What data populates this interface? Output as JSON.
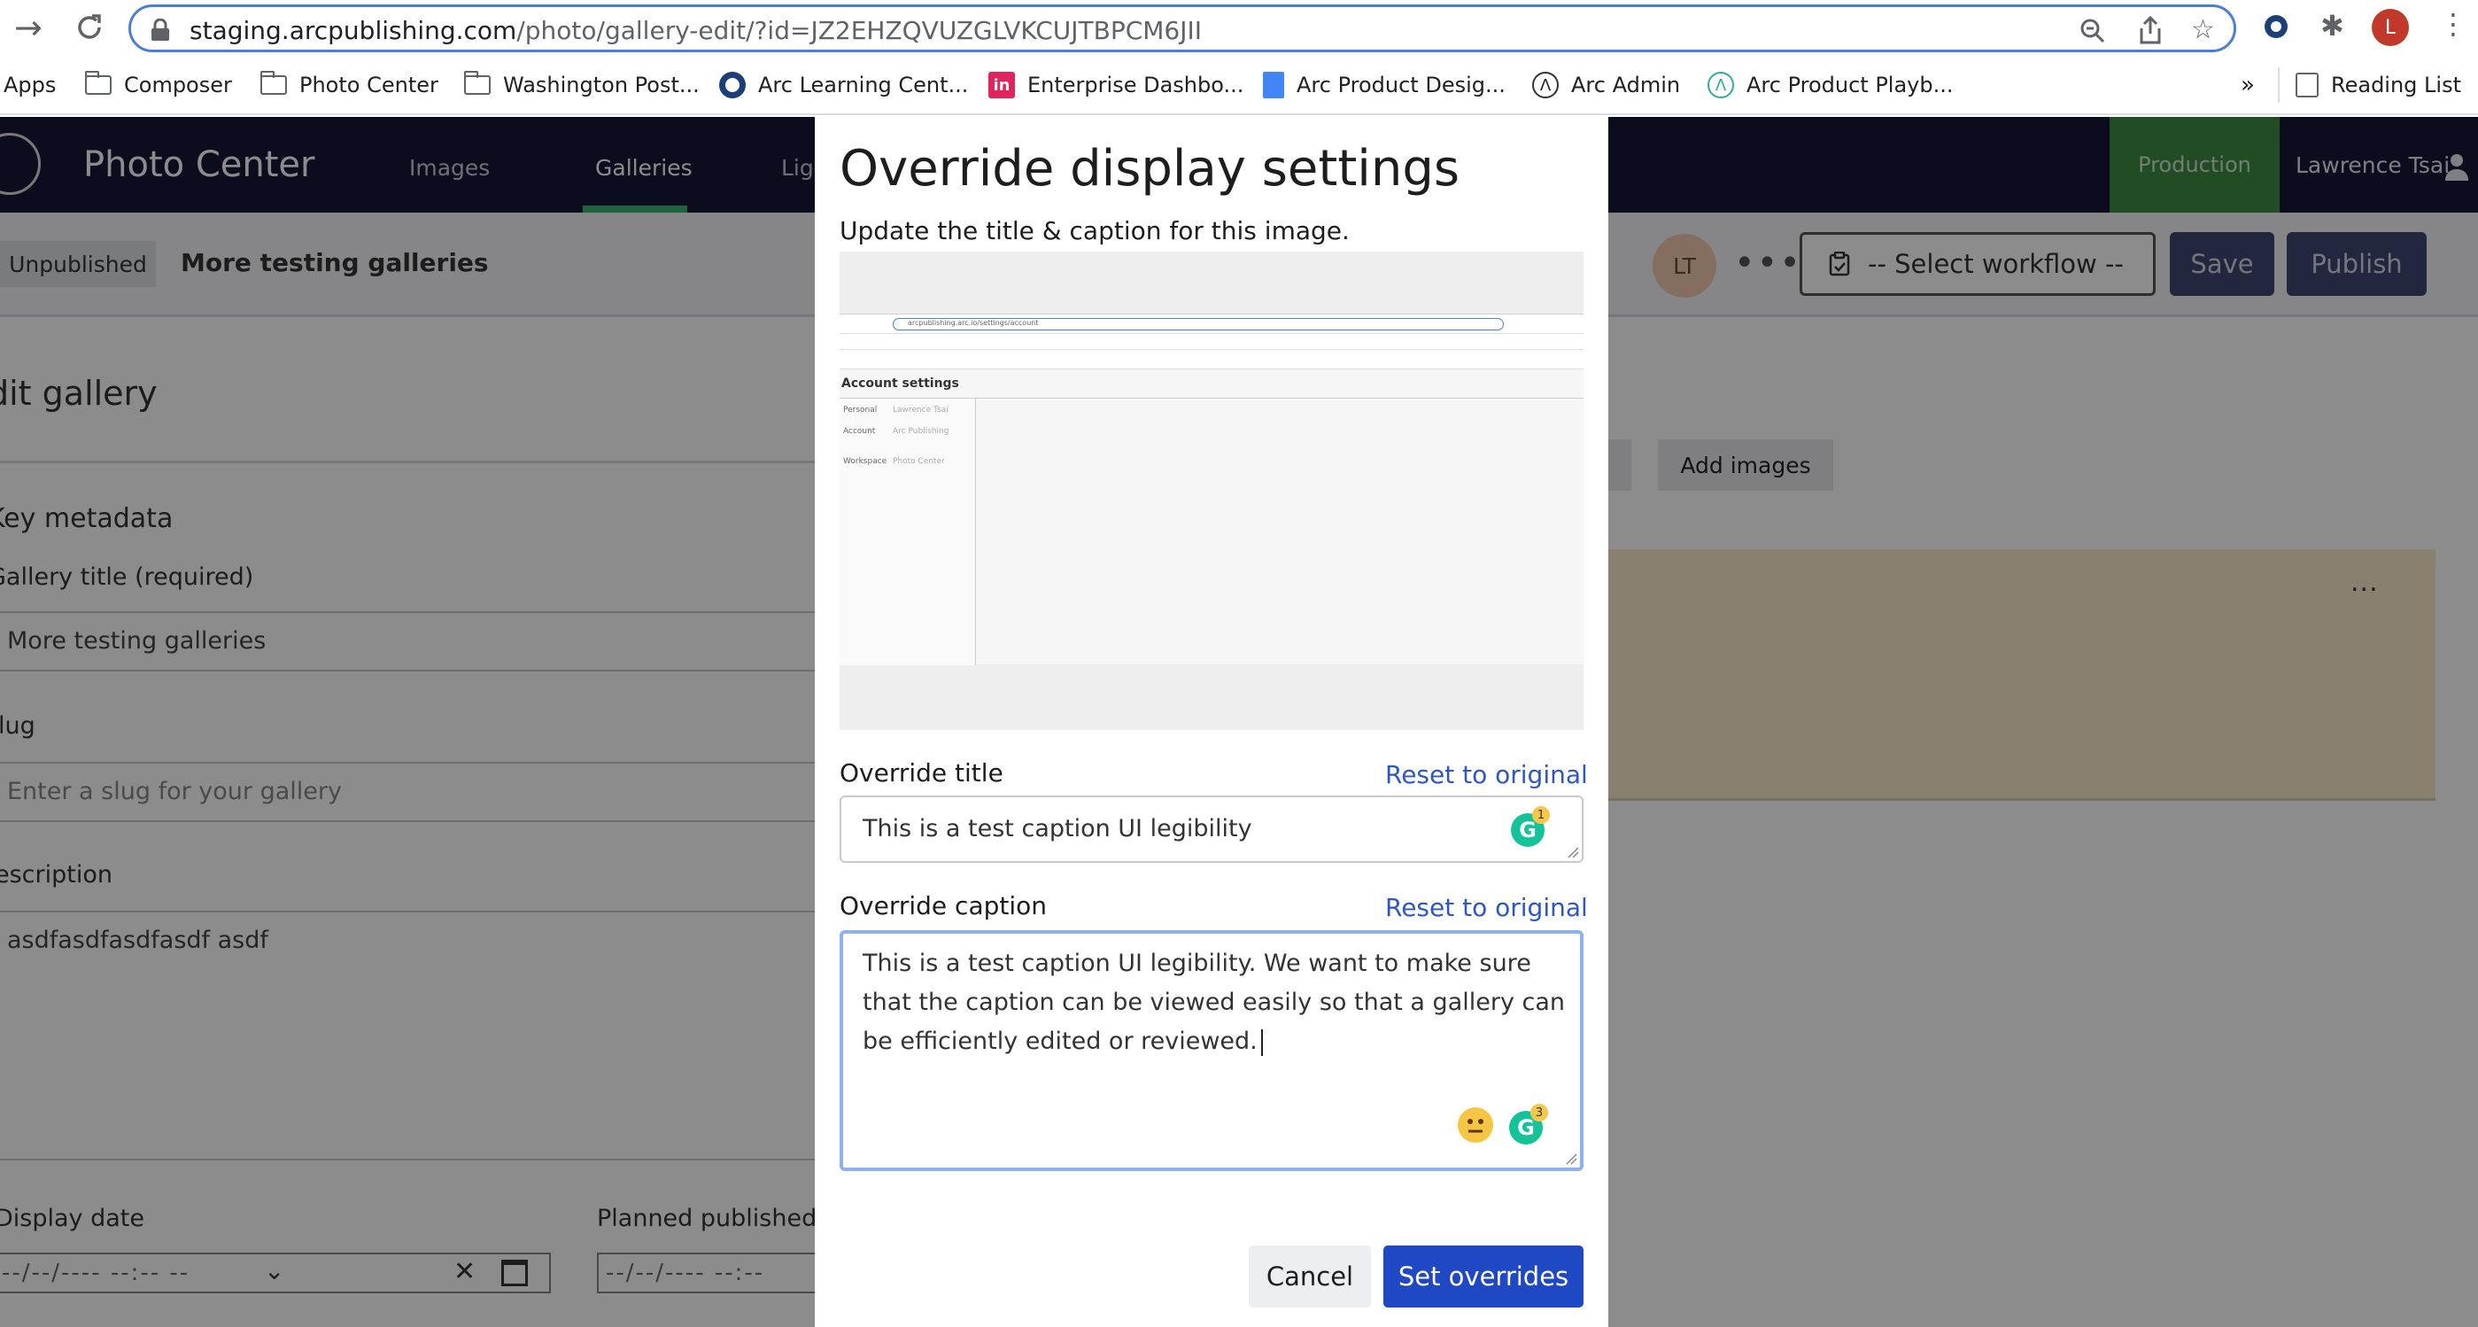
{
  "browser": {
    "url_host": "staging.arcpublishing.com",
    "url_path": "/photo/gallery-edit/?id=JZ2EHZQVUZGLVKCUJTBPCM6JII",
    "profile_initial": "L",
    "bookmarks": [
      {
        "label": "Apps",
        "icon": "apps-grid-icon"
      },
      {
        "label": "Composer",
        "icon": "folder-icon"
      },
      {
        "label": "Photo Center",
        "icon": "folder-icon"
      },
      {
        "label": "Washington Post...",
        "icon": "folder-icon"
      },
      {
        "label": "Arc Learning Cent...",
        "icon": "ring-icon"
      },
      {
        "label": "Enterprise Dashbo...",
        "icon": "invision-icon"
      },
      {
        "label": "Arc Product Desig...",
        "icon": "doc-icon"
      },
      {
        "label": "Arc Admin",
        "icon": "arc-icon"
      },
      {
        "label": "Arc Product Playb...",
        "icon": "arc-icon"
      }
    ],
    "overflow": "»",
    "reading_list": "Reading List"
  },
  "app": {
    "title": "Photo Center",
    "nav": [
      "Images",
      "Galleries",
      "Lig"
    ],
    "environment": "Production",
    "user_name": "Lawrence Tsai"
  },
  "toolbar": {
    "status": "Unpublished",
    "gallery_name": "More testing galleries",
    "avatar_initials": "LT",
    "more": "•••",
    "workflow_label": "-- Select workflow --",
    "save_label": "Save",
    "publish_label": "Publish"
  },
  "page": {
    "heading": "dit gallery",
    "section": "Key metadata",
    "title_label": "Gallery title (required)",
    "title_value": "More testing galleries",
    "slug_label": "lug",
    "slug_placeholder": "Enter a slug for your gallery",
    "description_label": "escription",
    "description_value": "asdfasdfasdfasdf asdf",
    "display_date_label": "Display date",
    "display_date_placeholder": "--/--/---- --:-- --",
    "planned_label": "Planned published",
    "planned_placeholder": "--/--/---- --:--",
    "add_images_label": "Add images",
    "card_more": "..."
  },
  "modal": {
    "title": "Override display settings",
    "subtitle": "Update the title & caption for this image.",
    "preview": {
      "heading": "Account settings",
      "url": "arcpublishing.arc.io/settings/account",
      "rows": [
        "Personal",
        "Account",
        "Workspace"
      ],
      "row_values": [
        "Lawrence Tsai",
        "Arc Publishing",
        "Photo Center"
      ]
    },
    "override_title_label": "Override title",
    "override_title_value": "This is a test caption UI legibility",
    "override_title_badge": "1",
    "override_caption_label": "Override caption",
    "override_caption_value": "This is a test caption UI legibility. We want to make sure that the caption can be viewed easily so that a gallery can be efficiently edited or reviewed.",
    "override_caption_badge": "3",
    "reset_label": "Reset to original",
    "cancel_label": "Cancel",
    "submit_label": "Set overrides"
  },
  "colors": {
    "header": "#15193a",
    "accent": "#1f48c4",
    "production": "#3d8a43",
    "link": "#2f56c5"
  }
}
